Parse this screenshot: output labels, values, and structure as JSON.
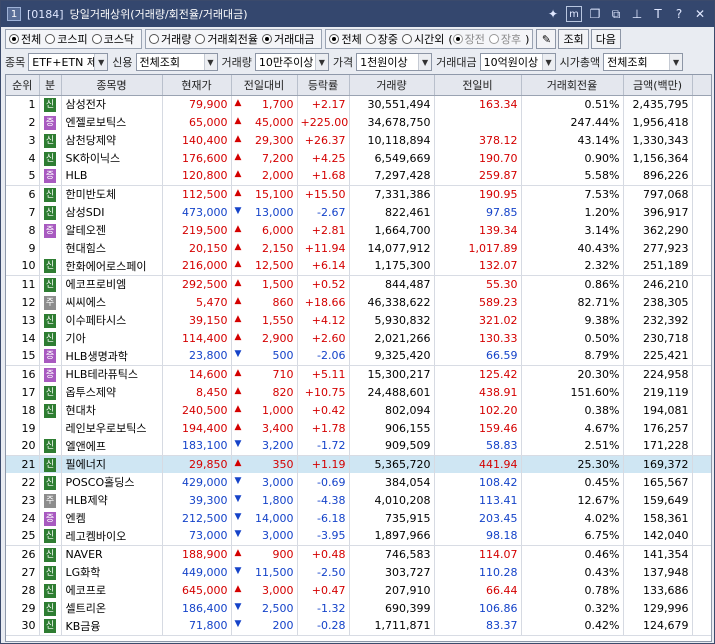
{
  "window": {
    "number": "1",
    "code": "[0184]",
    "title": "당일거래상위(거래량/회전율/거래대금)",
    "tool_icons": [
      "pin-icon",
      "menu-m-icon",
      "copy-window-icon",
      "link-icon",
      "pin2-icon",
      "font-t-icon",
      "help-icon",
      "close-icon"
    ]
  },
  "filters": {
    "market": {
      "options": [
        "전체",
        "코스피",
        "코스닥"
      ],
      "selected": "전체"
    },
    "sort": {
      "options": [
        "거래량",
        "거래회전율",
        "거래대금"
      ],
      "selected": "거래대금"
    },
    "session": {
      "options": [
        "전체",
        "장중",
        "시간외"
      ],
      "selected": "전체"
    },
    "after_hours": {
      "options": [
        "장전",
        "장후"
      ],
      "selected": "장전"
    },
    "query_button": "조회",
    "next_button": "다음"
  },
  "conditions": {
    "item_label": "종목",
    "item_value": "ETF+ETN 제",
    "credit_label": "신용",
    "credit_value": "전체조회",
    "volume_label": "거래량",
    "volume_value": "10만주이상",
    "price_label": "가격",
    "price_value": "1천원이상",
    "amount_label": "거래대금",
    "amount_value": "10억원이상",
    "cap_label": "시가총액",
    "cap_value": "전체조회"
  },
  "table": {
    "headers": [
      "순위",
      "분",
      "종목명",
      "현재가",
      "전일대비",
      "등락률",
      "거래량",
      "전일비",
      "거래회전율",
      "금액(백만)"
    ],
    "rows": [
      {
        "rank": "1",
        "badge": "신",
        "name": "삼성전자",
        "price": "79,900",
        "dir": "up",
        "change": "1,700",
        "rate": "+2.17",
        "volume": "30,551,494",
        "prev": "163.34",
        "turnover": "0.51%",
        "amount": "2,435,795"
      },
      {
        "rank": "2",
        "badge": "증",
        "name": "엔젤로보틱스",
        "price": "65,000",
        "dir": "up",
        "change": "45,000",
        "rate": "+225.00",
        "volume": "34,678,750",
        "prev": "",
        "turnover": "247.44%",
        "amount": "1,956,418"
      },
      {
        "rank": "3",
        "badge": "신",
        "name": "삼천당제약",
        "price": "140,400",
        "dir": "up",
        "change": "29,300",
        "rate": "+26.37",
        "volume": "10,118,894",
        "prev": "378.12",
        "turnover": "43.14%",
        "amount": "1,330,343"
      },
      {
        "rank": "4",
        "badge": "신",
        "name": "SK하이닉스",
        "price": "176,600",
        "dir": "up",
        "change": "7,200",
        "rate": "+4.25",
        "volume": "6,549,669",
        "prev": "190.70",
        "turnover": "0.90%",
        "amount": "1,156,364"
      },
      {
        "rank": "5",
        "badge": "증",
        "name": "HLB",
        "price": "120,800",
        "dir": "up",
        "change": "2,000",
        "rate": "+1.68",
        "volume": "7,297,428",
        "prev": "259.87",
        "turnover": "5.58%",
        "amount": "896,226"
      },
      {
        "rank": "6",
        "badge": "신",
        "name": "한미반도체",
        "price": "112,500",
        "dir": "up",
        "change": "15,100",
        "rate": "+15.50",
        "volume": "7,331,386",
        "prev": "190.95",
        "turnover": "7.53%",
        "amount": "797,068"
      },
      {
        "rank": "7",
        "badge": "신",
        "name": "삼성SDI",
        "price": "473,000",
        "dir": "down",
        "change": "13,000",
        "rate": "-2.67",
        "volume": "822,461",
        "prev": "97.85",
        "turnover": "1.20%",
        "amount": "396,917"
      },
      {
        "rank": "8",
        "badge": "증",
        "name": "알테오젠",
        "price": "219,500",
        "dir": "up",
        "change": "6,000",
        "rate": "+2.81",
        "volume": "1,664,700",
        "prev": "139.34",
        "turnover": "3.14%",
        "amount": "362,290"
      },
      {
        "rank": "9",
        "badge": "",
        "name": "현대힘스",
        "price": "20,150",
        "dir": "up",
        "change": "2,150",
        "rate": "+11.94",
        "volume": "14,077,912",
        "prev": "1,017.89",
        "turnover": "40.43%",
        "amount": "277,923"
      },
      {
        "rank": "10",
        "badge": "신",
        "name": "한화에어로스페이",
        "price": "216,000",
        "dir": "up",
        "change": "12,500",
        "rate": "+6.14",
        "volume": "1,175,300",
        "prev": "132.07",
        "turnover": "2.32%",
        "amount": "251,189"
      },
      {
        "rank": "11",
        "badge": "신",
        "name": "에코프로비엠",
        "price": "292,500",
        "dir": "up",
        "change": "1,500",
        "rate": "+0.52",
        "volume": "844,487",
        "prev": "55.30",
        "turnover": "0.86%",
        "amount": "246,210"
      },
      {
        "rank": "12",
        "badge": "주",
        "name": "씨씨에스",
        "price": "5,470",
        "dir": "up",
        "change": "860",
        "rate": "+18.66",
        "volume": "46,338,622",
        "prev": "589.23",
        "turnover": "82.71%",
        "amount": "238,305"
      },
      {
        "rank": "13",
        "badge": "신",
        "name": "이수페타시스",
        "price": "39,150",
        "dir": "up",
        "change": "1,550",
        "rate": "+4.12",
        "volume": "5,930,832",
        "prev": "321.02",
        "turnover": "9.38%",
        "amount": "232,392"
      },
      {
        "rank": "14",
        "badge": "신",
        "name": "기아",
        "price": "114,400",
        "dir": "up",
        "change": "2,900",
        "rate": "+2.60",
        "volume": "2,021,266",
        "prev": "130.33",
        "turnover": "0.50%",
        "amount": "230,718"
      },
      {
        "rank": "15",
        "badge": "증",
        "name": "HLB생명과학",
        "price": "23,800",
        "dir": "down",
        "change": "500",
        "rate": "-2.06",
        "volume": "9,325,420",
        "prev": "66.59",
        "turnover": "8.79%",
        "amount": "225,421"
      },
      {
        "rank": "16",
        "badge": "증",
        "name": "HLB테라퓨틱스",
        "price": "14,600",
        "dir": "up",
        "change": "710",
        "rate": "+5.11",
        "volume": "15,300,217",
        "prev": "125.42",
        "turnover": "20.30%",
        "amount": "224,958"
      },
      {
        "rank": "17",
        "badge": "신",
        "name": "옵투스제약",
        "price": "8,450",
        "dir": "up",
        "change": "820",
        "rate": "+10.75",
        "volume": "24,488,601",
        "prev": "438.91",
        "turnover": "151.60%",
        "amount": "219,119"
      },
      {
        "rank": "18",
        "badge": "신",
        "name": "현대차",
        "price": "240,500",
        "dir": "up",
        "change": "1,000",
        "rate": "+0.42",
        "volume": "802,094",
        "prev": "102.20",
        "turnover": "0.38%",
        "amount": "194,081"
      },
      {
        "rank": "19",
        "badge": "",
        "name": "레인보우로보틱스",
        "price": "194,400",
        "dir": "up",
        "change": "3,400",
        "rate": "+1.78",
        "volume": "906,155",
        "prev": "159.46",
        "turnover": "4.67%",
        "amount": "176,257"
      },
      {
        "rank": "20",
        "badge": "신",
        "name": "엘앤에프",
        "price": "183,100",
        "dir": "down",
        "change": "3,200",
        "rate": "-1.72",
        "volume": "909,509",
        "prev": "58.83",
        "turnover": "2.51%",
        "amount": "171,228"
      },
      {
        "rank": "21",
        "badge": "신",
        "name": "필에너지",
        "price": "29,850",
        "dir": "up",
        "change": "350",
        "rate": "+1.19",
        "volume": "5,365,720",
        "prev": "441.94",
        "turnover": "25.30%",
        "amount": "169,372"
      },
      {
        "rank": "22",
        "badge": "신",
        "name": "POSCO홀딩스",
        "price": "429,000",
        "dir": "down",
        "change": "3,000",
        "rate": "-0.69",
        "volume": "384,054",
        "prev": "108.42",
        "turnover": "0.45%",
        "amount": "165,567"
      },
      {
        "rank": "23",
        "badge": "주",
        "name": "HLB제약",
        "price": "39,300",
        "dir": "down",
        "change": "1,800",
        "rate": "-4.38",
        "volume": "4,010,208",
        "prev": "113.41",
        "turnover": "12.67%",
        "amount": "159,649"
      },
      {
        "rank": "24",
        "badge": "증",
        "name": "엔켐",
        "price": "212,500",
        "dir": "down",
        "change": "14,000",
        "rate": "-6.18",
        "volume": "735,915",
        "prev": "203.45",
        "turnover": "4.02%",
        "amount": "158,361"
      },
      {
        "rank": "25",
        "badge": "신",
        "name": "레고켐바이오",
        "price": "73,000",
        "dir": "down",
        "change": "3,000",
        "rate": "-3.95",
        "volume": "1,897,966",
        "prev": "98.18",
        "turnover": "6.75%",
        "amount": "142,040"
      },
      {
        "rank": "26",
        "badge": "신",
        "name": "NAVER",
        "price": "188,900",
        "dir": "up",
        "change": "900",
        "rate": "+0.48",
        "volume": "746,583",
        "prev": "114.07",
        "turnover": "0.46%",
        "amount": "141,354"
      },
      {
        "rank": "27",
        "badge": "신",
        "name": "LG화학",
        "price": "449,000",
        "dir": "down",
        "change": "11,500",
        "rate": "-2.50",
        "volume": "303,727",
        "prev": "110.28",
        "turnover": "0.43%",
        "amount": "137,948"
      },
      {
        "rank": "28",
        "badge": "신",
        "name": "에코프로",
        "price": "645,000",
        "dir": "up",
        "change": "3,000",
        "rate": "+0.47",
        "volume": "207,910",
        "prev": "66.44",
        "turnover": "0.78%",
        "amount": "133,686"
      },
      {
        "rank": "29",
        "badge": "신",
        "name": "셀트리온",
        "price": "186,400",
        "dir": "down",
        "change": "2,500",
        "rate": "-1.32",
        "volume": "690,399",
        "prev": "106.86",
        "turnover": "0.32%",
        "amount": "129,996"
      },
      {
        "rank": "30",
        "badge": "신",
        "name": "KB금융",
        "price": "71,800",
        "dir": "down",
        "change": "200",
        "rate": "-0.28",
        "volume": "1,711,871",
        "prev": "83.37",
        "turnover": "0.42%",
        "amount": "124,679"
      }
    ]
  },
  "colors": {
    "up": "#d40000",
    "down": "#1543c9",
    "title_bar": "#34476e",
    "highlight_row": "#cfe6f3"
  }
}
